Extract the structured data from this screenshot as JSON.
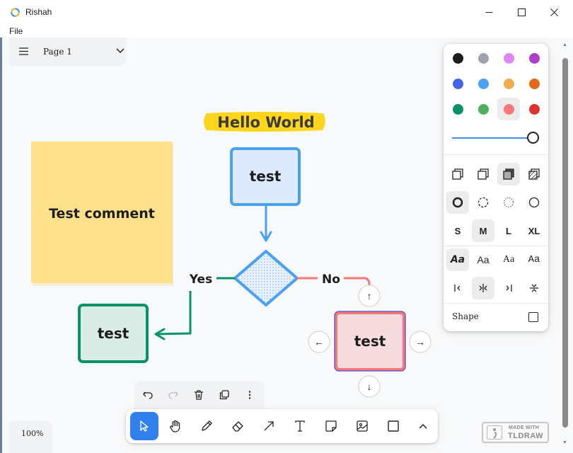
{
  "window": {
    "title": "Rishah",
    "menu": [
      "File"
    ]
  },
  "page_menu": {
    "label": "Page 1"
  },
  "canvas": {
    "title_text": "Hello World",
    "sticky_note": "Test comment",
    "box_top": "test",
    "box_left": "test",
    "box_right": "test",
    "label_yes": "Yes",
    "label_no": "No",
    "handles": {
      "up": "↑",
      "left": "←",
      "right": "→",
      "down": "↓"
    }
  },
  "style_panel": {
    "colors": [
      "#1d1d1d",
      "#9ea3ab",
      "#e085f4",
      "#ae3ec9",
      "#4465e9",
      "#4ba1f1",
      "#f1ac4b",
      "#e16919",
      "#099268",
      "#4cb05e",
      "#f87777",
      "#e03131"
    ],
    "selected_color": "#f87777",
    "sizes": [
      "S",
      "M",
      "L",
      "XL"
    ],
    "selected_size": "M",
    "font_samples": [
      "Aa",
      "Aa",
      "Aa",
      "Aa"
    ],
    "shape_label": "Shape"
  },
  "zoom": {
    "label": "100%"
  },
  "watermark": {
    "made": "MADE WITH",
    "brand": "TLDRAW"
  }
}
